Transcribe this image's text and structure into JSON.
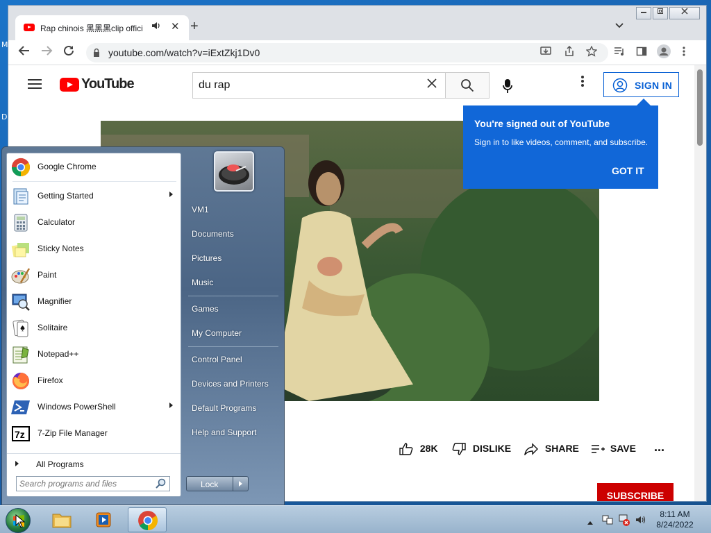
{
  "desktop": {
    "label_1": "M",
    "label_2": "D"
  },
  "browser": {
    "tab": {
      "title": "Rap chinois 黑黑黑clip offici",
      "audio_icon": "speaker-icon",
      "close": "✕"
    },
    "new_tab": "+",
    "tab_list": "⌄",
    "window_controls": {
      "minimize": "▭",
      "maximize": "▣",
      "close": "✕"
    },
    "url": "youtube.com/watch?v=iExtZkj1Dv0"
  },
  "youtube": {
    "logo_text": "YouTube",
    "search_value": "du rap",
    "signin_label": "SIGN IN",
    "tooltip": {
      "title": "You're signed out of YouTube",
      "body": "Sign in to like videos, comment, and subscribe.",
      "button": "GOT IT"
    },
    "actions": {
      "like_count": "28K",
      "dislike": "DISLIKE",
      "share": "SHARE",
      "save": "SAVE",
      "more": "..."
    },
    "subscribe": "SUBSCRIBE",
    "colors": {
      "brand": "#ff0000",
      "accent": "#065fd4",
      "tooltip_bg": "#1167d8"
    }
  },
  "start_menu": {
    "programs": [
      {
        "label": "Google Chrome",
        "icon": "chrome-icon",
        "submenu": false
      },
      {
        "label": "Getting Started",
        "icon": "getting-started-icon",
        "submenu": true
      },
      {
        "label": "Calculator",
        "icon": "calculator-icon",
        "submenu": false
      },
      {
        "label": "Sticky Notes",
        "icon": "sticky-notes-icon",
        "submenu": false
      },
      {
        "label": "Paint",
        "icon": "paint-icon",
        "submenu": false
      },
      {
        "label": "Magnifier",
        "icon": "magnifier-icon",
        "submenu": false
      },
      {
        "label": "Solitaire",
        "icon": "solitaire-icon",
        "submenu": false
      },
      {
        "label": "Notepad++",
        "icon": "notepadpp-icon",
        "submenu": false
      },
      {
        "label": "Firefox",
        "icon": "firefox-icon",
        "submenu": false
      },
      {
        "label": "Windows PowerShell",
        "icon": "powershell-icon",
        "submenu": true
      },
      {
        "label": "7-Zip File Manager",
        "icon": "7zip-icon",
        "submenu": false
      }
    ],
    "all_programs": "All Programs",
    "search_placeholder": "Search programs and files",
    "right_links": [
      "VM1",
      "Documents",
      "Pictures",
      "Music",
      "Games",
      "My Computer",
      "Control Panel",
      "Devices and Printers",
      "Default Programs",
      "Help and Support"
    ],
    "lock_label": "Lock"
  },
  "taskbar": {
    "time": "8:11 AM",
    "date": "8/24/2022"
  }
}
